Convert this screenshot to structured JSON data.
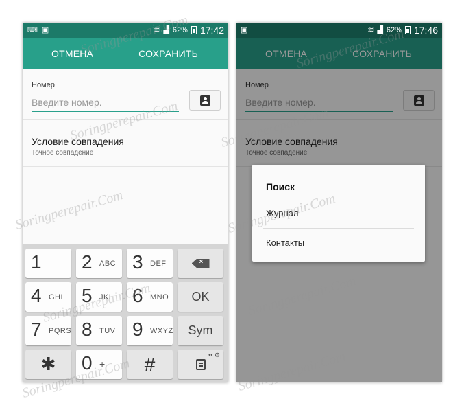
{
  "left_screen": {
    "status": {
      "battery": "62%",
      "time": "17:42"
    },
    "actionbar": {
      "cancel": "ОТМЕНА",
      "save": "СОХРАНИТЬ"
    },
    "number_field": {
      "label": "Номер",
      "placeholder": "Введите номер."
    },
    "match": {
      "title": "Условие совпадения",
      "subtitle": "Точное совпадение"
    },
    "keyboard": {
      "rows": [
        [
          {
            "num": "1",
            "sub": ""
          },
          {
            "num": "2",
            "sub": "ABC"
          },
          {
            "num": "3",
            "sub": "DEF"
          }
        ],
        [
          {
            "num": "4",
            "sub": "GHI"
          },
          {
            "num": "5",
            "sub": "JKL"
          },
          {
            "num": "6",
            "sub": "MNO"
          }
        ],
        [
          {
            "num": "7",
            "sub": "PQRS"
          },
          {
            "num": "8",
            "sub": "TUV"
          },
          {
            "num": "9",
            "sub": "WXYZ"
          }
        ],
        [
          {
            "num": "✱",
            "sub": ""
          },
          {
            "num": "0",
            "sub": "+"
          },
          {
            "num": "#",
            "sub": ""
          }
        ]
      ],
      "ok": "OK",
      "sym": "Sym"
    }
  },
  "right_screen": {
    "status": {
      "battery": "62%",
      "time": "17:46"
    },
    "actionbar": {
      "cancel": "ОТМЕНА",
      "save": "СОХРАНИТЬ"
    },
    "number_field": {
      "label": "Номер",
      "placeholder": "Введите номер."
    },
    "match": {
      "title": "Условие совпадения",
      "subtitle": "Точное совпадение"
    },
    "dialog": {
      "title": "Поиск",
      "item1": "Журнал",
      "item2": "Контакты"
    }
  },
  "watermark": "Soringperepair.Com",
  "colors": {
    "actionbar": "#28a08a",
    "statusbar": "#1c7a68",
    "accent_line": "#2aa08c"
  }
}
